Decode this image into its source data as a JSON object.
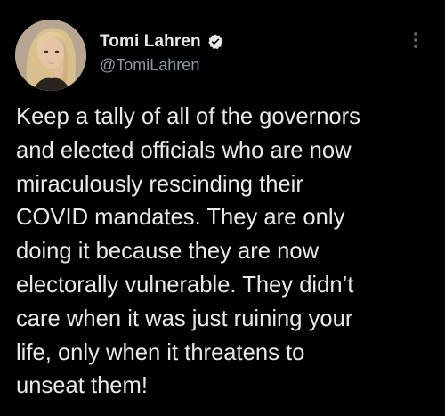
{
  "tweet": {
    "author": {
      "display_name": "Tomi Lahren",
      "handle": "@TomiLahren",
      "verified_icon": "verified-badge-icon",
      "avatar_icon": "profile-photo"
    },
    "more_icon": "more-options-icon",
    "text_lines": [
      "Keep a tally of all of the governors",
      "and elected officials who are now",
      "miraculously rescinding their",
      "COVID mandates. They are only",
      "doing it because they are now",
      "electorally vulnerable. They didn’t",
      "care when it was just ruining your",
      "life, only when it threatens to",
      "unseat them!"
    ]
  },
  "colors": {
    "background": "#000000",
    "text_primary": "#e7e9ea",
    "text_secondary": "#8b98a5"
  }
}
